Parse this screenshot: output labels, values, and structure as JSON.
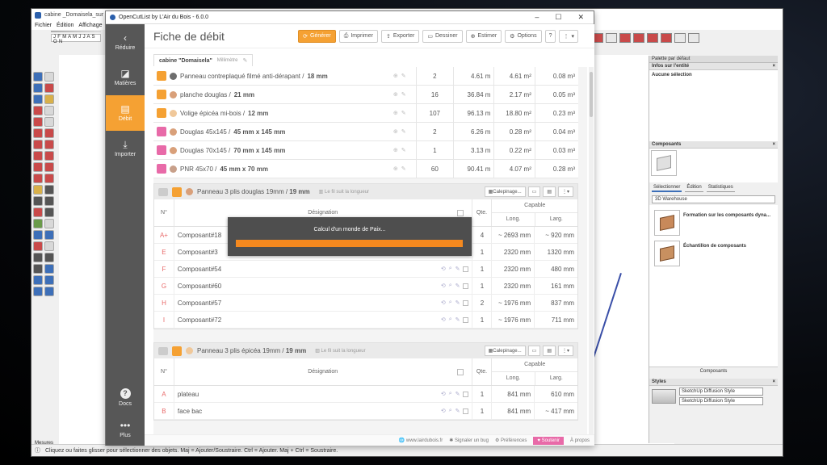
{
  "sketchup": {
    "title": "cabine _Domaisela_sur da",
    "menu": [
      "Fichier",
      "Édition",
      "Affichage"
    ],
    "months": "J F M A M J J A S O N",
    "measures_label": "Mesures",
    "status_text": "Cliquez ou faites glisser pour sélectionner des objets. Maj = Ajouter/Soustraire. Ctrl = Ajouter. Maj + Ctrl = Soustraire."
  },
  "palette": {
    "header": "Palette par défaut",
    "entity_section": "Infos sur l'entité",
    "no_selection": "Aucune sélection",
    "components_section": "Composants",
    "tabs": [
      "Sélectionner",
      "Édition",
      "Statistiques"
    ],
    "search_value": "3D Warehouse",
    "components": [
      {
        "label": "Formation sur les composants dyna..."
      },
      {
        "label": "Échantillon de composants"
      }
    ],
    "components_footer": "Composants",
    "styles_section": "Styles",
    "styles": [
      "SketchUp Diffusion Style",
      "SketchUp Diffusion Style"
    ]
  },
  "ocl": {
    "window_title": "OpenCutList by L'Air du Bois - 6.0.0",
    "win_min": "–",
    "win_max": "☐",
    "win_close": "✕",
    "sidebar": {
      "reduce": "Réduire",
      "materials": "Matières",
      "cutlist": "Débit",
      "import": "Importer",
      "docs": "Docs",
      "more": "Plus"
    },
    "page_title": "Fiche de débit",
    "actions": {
      "generate": "Générer",
      "print": "Imprimer",
      "export": "Exporter",
      "draw": "Dessiner",
      "estimate": "Estimer",
      "options": "Options",
      "help": "?",
      "more": "⋮"
    },
    "doc_name": "cabine \"Domaisela\"",
    "doc_unit": "Millimètre",
    "materials": [
      {
        "type": "sheet",
        "swatch": "#6e6e6e",
        "name": "Panneau contreplaqué filmé anti-dérapant / ",
        "dim": "18 mm",
        "count": "2",
        "length": "4.61 m",
        "area": "4.61 m²",
        "volume": "0.08 m³"
      },
      {
        "type": "sheet",
        "swatch": "#d9a07a",
        "name": "planche douglas / ",
        "dim": "21 mm",
        "count": "16",
        "length": "36.84 m",
        "area": "2.17 m²",
        "volume": "0.05 m³"
      },
      {
        "type": "sheet",
        "swatch": "#f0c89a",
        "name": "Volige épicéa mi-bois / ",
        "dim": "12 mm",
        "count": "107",
        "length": "96.13 m",
        "area": "18.80 m²",
        "volume": "0.23 m³"
      },
      {
        "type": "dim",
        "swatch": "#d9a07a",
        "name": "Douglas 45x145 / ",
        "dim": "45 mm x 145 mm",
        "count": "2",
        "length": "6.26 m",
        "area": "0.28 m²",
        "volume": "0.04 m³"
      },
      {
        "type": "dim",
        "swatch": "#d9a07a",
        "name": "Douglas 70x145 / ",
        "dim": "70 mm x 145 mm",
        "count": "1",
        "length": "3.13 m",
        "area": "0.22 m²",
        "volume": "0.03 m³"
      },
      {
        "type": "dim",
        "swatch": "#c8a08a",
        "name": "PNR 45x70 / ",
        "dim": "45 mm x 70 mm",
        "count": "60",
        "length": "90.41 m",
        "area": "4.07 m²",
        "volume": "0.28 m³"
      }
    ],
    "groups": [
      {
        "swatch": "#d9a07a",
        "name": "Panneau 3 plis douglas 19mm / ",
        "dim": "19 mm",
        "grain": "Le fil suit la longueur",
        "btn_layout": "Calepinage...",
        "hdr_num": "N°",
        "hdr_designation": "Désignation",
        "hdr_qte": "Qte.",
        "hdr_cap": "Capable",
        "hdr_long": "Long.",
        "hdr_larg": "Larg.",
        "parts": [
          {
            "num": "A+",
            "name": "Composant#18",
            "qte": "4",
            "long": "~ 2693 mm",
            "larg": "~ 920 mm"
          },
          {
            "num": "E",
            "name": "Composant#3",
            "qte": "1",
            "long": "2320 mm",
            "larg": "1320 mm"
          },
          {
            "num": "F",
            "name": "Composant#54",
            "qte": "1",
            "long": "2320 mm",
            "larg": "480 mm"
          },
          {
            "num": "G",
            "name": "Composant#60",
            "qte": "1",
            "long": "2320 mm",
            "larg": "161 mm"
          },
          {
            "num": "H",
            "name": "Composant#57",
            "qte": "2",
            "long": "~ 1976 mm",
            "larg": "837 mm"
          },
          {
            "num": "I",
            "name": "Composant#72",
            "qte": "1",
            "long": "~ 1976 mm",
            "larg": "711 mm"
          }
        ]
      },
      {
        "swatch": "#f0c89a",
        "name": "Panneau 3 plis épicéa 19mm / ",
        "dim": "19 mm",
        "grain": "Le fil suit la longueur",
        "btn_layout": "Calepinage...",
        "hdr_num": "N°",
        "hdr_designation": "Désignation",
        "hdr_qte": "Qte.",
        "hdr_cap": "Capable",
        "hdr_long": "Long.",
        "hdr_larg": "Larg.",
        "parts": [
          {
            "num": "A",
            "name": "plateau",
            "qte": "1",
            "long": "841 mm",
            "larg": "610 mm"
          },
          {
            "num": "B",
            "name": "face bac",
            "qte": "1",
            "long": "841 mm",
            "larg": "~ 417 mm"
          }
        ]
      }
    ],
    "progress": {
      "label": "Calcul d'un monde de Paix...",
      "value": 100
    },
    "footer": {
      "site": "www.lairdubois.fr",
      "bug": "Signaler un bug",
      "prefs": "Préférences",
      "support": "Soutenir",
      "about": "À propos"
    },
    "colors": {
      "accent": "#f5a133",
      "sidebar": "#575757",
      "support": "#e86aa8",
      "progress": "#f5891f"
    }
  }
}
